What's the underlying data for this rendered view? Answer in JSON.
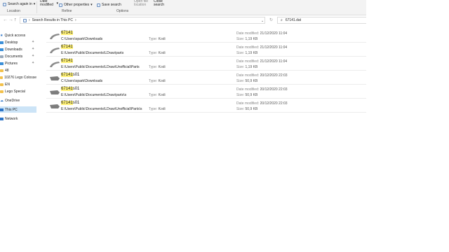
{
  "ribbon": {
    "search_again": "Search again in",
    "date_modified": "Date modified",
    "other_properties": "Other properties",
    "save_search": "Save search",
    "open_file_location": "Open file location",
    "close_search": "Close search",
    "groups": {
      "location": "Location",
      "refine": "Refine",
      "options": "Options"
    }
  },
  "address": {
    "breadcrumb": "Search Results in This PC",
    "search_value": "67141.dat"
  },
  "sidebar": {
    "items": [
      {
        "label": "Quick access",
        "icon": "star-icon",
        "pinned": false
      },
      {
        "label": "Desktop",
        "icon": "desktop-folder-icon",
        "pinned": true
      },
      {
        "label": "Downloads",
        "icon": "download-folder-icon",
        "pinned": true
      },
      {
        "label": "Documents",
        "icon": "documents-folder-icon",
        "pinned": true
      },
      {
        "label": "Pictures",
        "icon": "pictures-folder-icon",
        "pinned": true
      },
      {
        "label": "48",
        "icon": "folder-icon",
        "pinned": false
      },
      {
        "label": "10276 Lego Colosse",
        "icon": "folder-icon",
        "pinned": false
      },
      {
        "label": "EN",
        "icon": "folder-icon",
        "pinned": false
      },
      {
        "label": "Lego Special",
        "icon": "folder-icon",
        "pinned": false
      },
      {
        "label": "OneDrive",
        "icon": "cloud-icon",
        "pinned": false
      },
      {
        "label": "This PC",
        "icon": "computer-icon",
        "pinned": false
      },
      {
        "label": "Network",
        "icon": "network-icon",
        "pinned": false
      }
    ]
  },
  "labels": {
    "type": "Type:",
    "date_modified": "Date modified:",
    "size": "Size:"
  },
  "results": [
    {
      "name_match": "67141",
      "name_rest": "",
      "path": "C:\\Users\\spark\\Downloads",
      "type": "Kodi",
      "date": "21/12/2020 11:04",
      "size": "1,19 KB"
    },
    {
      "name_match": "67141",
      "name_rest": "",
      "path": "E:\\Users\\Public\\Documents\\LDraw\\parts",
      "type": "Kodi",
      "date": "21/12/2020 11:04",
      "size": "1,19 KB"
    },
    {
      "name_match": "67141",
      "name_rest": "",
      "path": "E:\\Users\\Public\\Documents\\LDraw\\Unofficial\\Parts",
      "type": "Kodi",
      "date": "21/12/2020 11:04",
      "size": "1,19 KB"
    },
    {
      "name_match": "67141",
      "name_rest": "s01",
      "path": "C:\\Users\\spark\\Downloads",
      "type": "Kodi",
      "date": "20/12/2020 22:03",
      "size": "50,9 KB"
    },
    {
      "name_match": "67141",
      "name_rest": "s01",
      "path": "E:\\Users\\Public\\Documents\\LDraw\\parts\\s",
      "type": "Kodi",
      "date": "20/12/2020 22:03",
      "size": "50,9 KB"
    },
    {
      "name_match": "67141",
      "name_rest": "s01",
      "path": "E:\\Users\\Public\\Documents\\LDraw\\Unofficial\\Parts\\s",
      "type": "Kodi",
      "date": "20/12/2020 22:03",
      "size": "50,9 KB"
    }
  ]
}
